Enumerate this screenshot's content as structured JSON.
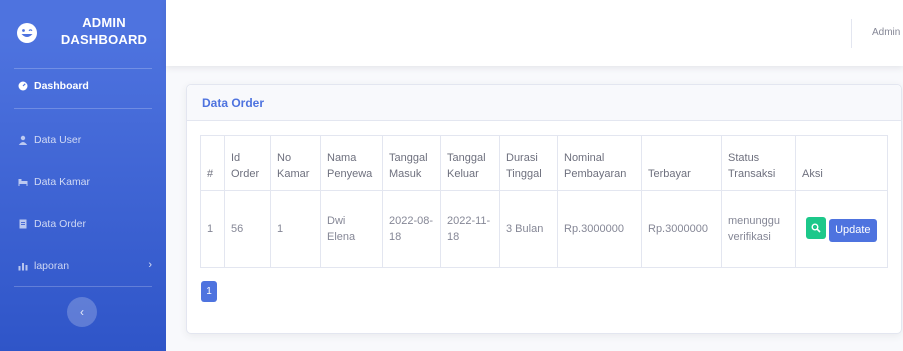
{
  "brand": {
    "line1": "ADMIN",
    "line2": "DASHBOARD",
    "icon": "laugh-wink-icon"
  },
  "sidebar": {
    "items": [
      {
        "label": "Dashboard",
        "icon": "tachometer-icon"
      },
      {
        "label": "Data User",
        "icon": "user-icon"
      },
      {
        "label": "Data Kamar",
        "icon": "bed-icon"
      },
      {
        "label": "Data Order",
        "icon": "file-icon"
      },
      {
        "label": "laporan",
        "icon": "chart-icon"
      }
    ],
    "toggle_glyph": "‹"
  },
  "topbar": {
    "user": "Admin"
  },
  "card": {
    "title": "Data Order"
  },
  "table": {
    "headers": [
      "#",
      "Id Order",
      "No Kamar",
      "Nama Penyewa",
      "Tanggal Masuk",
      "Tanggal Keluar",
      "Durasi Tinggal",
      "Nominal Pembayaran",
      "Terbayar",
      "Status Transaksi",
      "Aksi"
    ],
    "rows": [
      {
        "no": "1",
        "id_order": "56",
        "no_kamar": "1",
        "nama": "Dwi Elena",
        "tgl_masuk": "2022-08-18",
        "tgl_keluar": "2022-11-18",
        "durasi": "3 Bulan",
        "nominal": "Rp.3000000",
        "terbayar": "Rp.3000000",
        "status": "menunggu verifikasi",
        "update_label": "Update"
      }
    ]
  },
  "pagination": {
    "current": "1"
  },
  "colors": {
    "primary": "#4e73df",
    "success": "#1cc88a",
    "text_muted": "#858796"
  }
}
